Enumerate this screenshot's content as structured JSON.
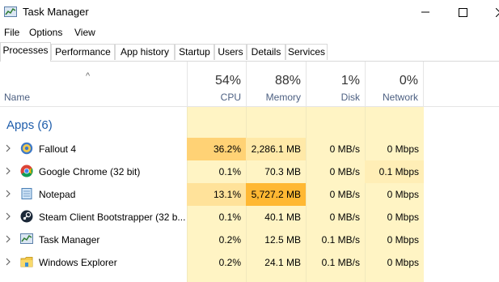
{
  "window": {
    "title": "Task Manager"
  },
  "menu": [
    "File",
    "Options",
    "View"
  ],
  "tabs": [
    "Processes",
    "Performance",
    "App history",
    "Startup",
    "Users",
    "Details",
    "Services"
  ],
  "columns": {
    "name": "Name",
    "cpu": {
      "pct": "54%",
      "label": "CPU"
    },
    "memory": {
      "pct": "88%",
      "label": "Memory"
    },
    "disk": {
      "pct": "1%",
      "label": "Disk"
    },
    "network": {
      "pct": "0%",
      "label": "Network"
    }
  },
  "group": {
    "title": "Apps (6)"
  },
  "rows": [
    {
      "name": "Fallout 4",
      "icon": "fallout-icon",
      "cpu": "36.2%",
      "memory": "2,286.1 MB",
      "disk": "0 MB/s",
      "network": "0 Mbps"
    },
    {
      "name": "Google Chrome (32 bit)",
      "icon": "chrome-icon",
      "cpu": "0.1%",
      "memory": "70.3 MB",
      "disk": "0 MB/s",
      "network": "0.1 Mbps"
    },
    {
      "name": "Notepad",
      "icon": "notepad-icon",
      "cpu": "13.1%",
      "memory": "5,727.2 MB",
      "disk": "0 MB/s",
      "network": "0 Mbps"
    },
    {
      "name": "Steam Client Bootstrapper (32 b...",
      "icon": "steam-icon",
      "cpu": "0.1%",
      "memory": "40.1 MB",
      "disk": "0 MB/s",
      "network": "0 Mbps"
    },
    {
      "name": "Task Manager",
      "icon": "task-manager-icon",
      "cpu": "0.2%",
      "memory": "12.5 MB",
      "disk": "0.1 MB/s",
      "network": "0 Mbps"
    },
    {
      "name": "Windows Explorer",
      "icon": "folder-icon",
      "cpu": "0.2%",
      "memory": "24.1 MB",
      "disk": "0.1 MB/s",
      "network": "0 Mbps"
    }
  ],
  "heat_colors": {
    "light": "#fff4c4",
    "medium": "#ffe9a8",
    "high": "#ffd275",
    "highest": "#ffb833"
  }
}
